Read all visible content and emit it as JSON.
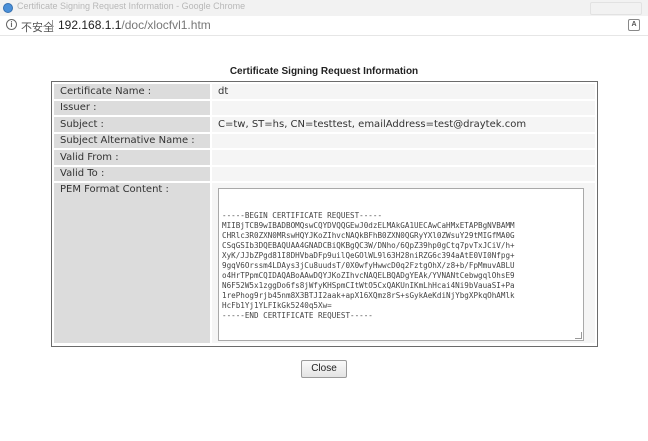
{
  "window": {
    "title": "Certificate Signing Request Information - Google Chrome"
  },
  "addressbar": {
    "security_label": "不安全",
    "url_host": "192.168.1.1",
    "url_path": "/doc/xlocfvl1.htm",
    "translate_icon_glyph": "A"
  },
  "page": {
    "heading": "Certificate Signing Request Information",
    "fields": [
      {
        "label": "Certificate Name :",
        "value": "dt"
      },
      {
        "label": "Issuer :",
        "value": ""
      },
      {
        "label": "Subject :",
        "value": "C=tw, ST=hs, CN=testtest, emailAddress=test@draytek.com"
      },
      {
        "label": "Subject Alternative Name :",
        "value": ""
      },
      {
        "label": "Valid From :",
        "value": ""
      },
      {
        "label": "Valid To :",
        "value": ""
      }
    ],
    "pem": {
      "label": "PEM Format Content :",
      "content": "-----BEGIN CERTIFICATE REQUEST-----\nMIIBjTCB9wIBADBOMQswCQYDVQQGEwJ0dzELMAkGA1UECAwCaHMxETAPBgNVBAMM\nCHRlc3R0ZXN0MRswHQYJKoZIhvcNAQkBFhB0ZXN0QGRyYXl0ZWsuY29tMIGfMA0G\nCSqGSIb3DQEBAQUAA4GNADCBiQKBgQC3W/DNho/6QpZ39hp0gCtq7pvTxJCiV/h+\nXyK/JJbZPgd81I8DHVbaDFp9uilQeGOlWL9l63H28niRZG6c394aAtE0VI0Nfpg+\n9gqV6Orssm4LDAys3jCu8uudsT/0X0wfyHwwcD0q2FztgOhX/z8+b/FpMmuvABLU\no4HrTPpmCQIDAQABoAAwDQYJKoZIhvcNAQELBQADgYEAk/YVNANtCebwgqlOhsE9\nN6F52W5x1zggDo6fs8jWfyKHSpmCItWtO5CxQAKUnIKmLhHcai4Ni9bVauaSI+Pa\n1rePhog9rjb45nm8X3BTJI2aak+apX16XQmz8rS+sGykAeKdiNjYbgXPkqOhAMlk\nHcFb1Yj1YLFIkGk5240q5Xw=\n-----END CERTIFICATE REQUEST-----"
    },
    "close_label": "Close"
  }
}
